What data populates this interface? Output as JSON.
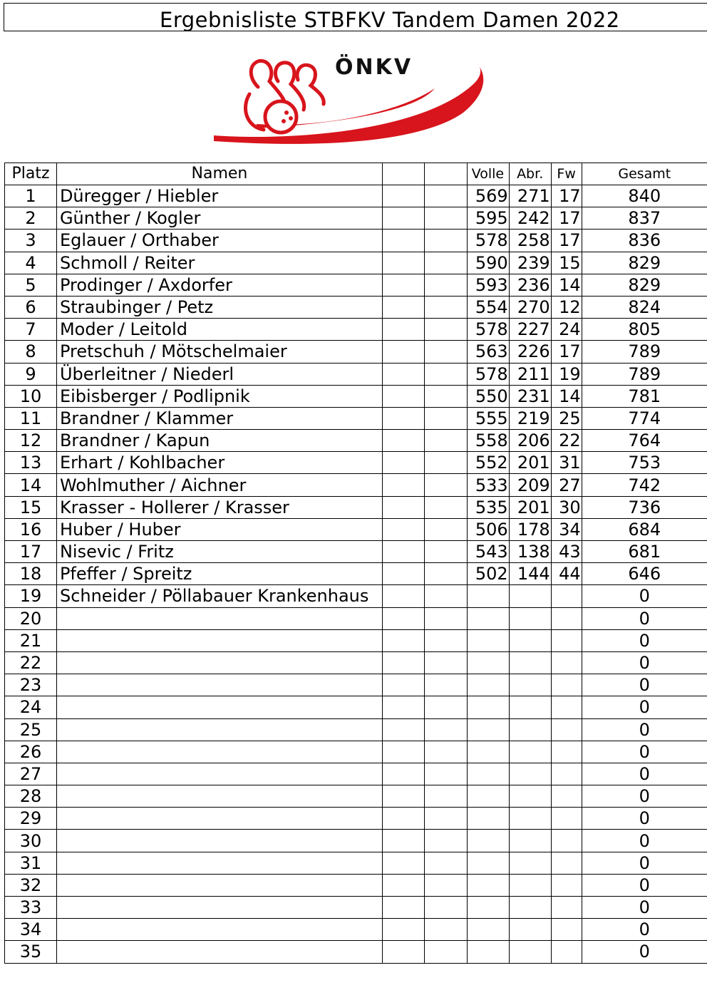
{
  "title": "Ergebnisliste STBFKV Tandem Damen 2022",
  "logo": {
    "text": "ÖNKV",
    "icon": "bowling-pin-logo",
    "colors": {
      "red": "#d8141c",
      "black": "#111111"
    }
  },
  "table": {
    "headers": {
      "platz": "Platz",
      "namen": "Namen",
      "volle": "Volle",
      "abr": "Abr.",
      "fw": "Fw",
      "gesamt": "Gesamt"
    },
    "rows": [
      {
        "platz": "1",
        "name": "Düregger / Hiebler",
        "volle": "569",
        "abr": "271",
        "fw": "17",
        "gesamt": "840"
      },
      {
        "platz": "2",
        "name": "Günther / Kogler",
        "volle": "595",
        "abr": "242",
        "fw": "17",
        "gesamt": "837"
      },
      {
        "platz": "3",
        "name": "Eglauer / Orthaber",
        "volle": "578",
        "abr": "258",
        "fw": "17",
        "gesamt": "836"
      },
      {
        "platz": "4",
        "name": "Schmoll / Reiter",
        "volle": "590",
        "abr": "239",
        "fw": "15",
        "gesamt": "829"
      },
      {
        "platz": "5",
        "name": "Prodinger / Axdorfer",
        "volle": "593",
        "abr": "236",
        "fw": "14",
        "gesamt": "829"
      },
      {
        "platz": "6",
        "name": "Straubinger / Petz",
        "volle": "554",
        "abr": "270",
        "fw": "12",
        "gesamt": "824"
      },
      {
        "platz": "7",
        "name": "Moder / Leitold",
        "volle": "578",
        "abr": "227",
        "fw": "24",
        "gesamt": "805"
      },
      {
        "platz": "8",
        "name": "Pretschuh / Mötschelmaier",
        "volle": "563",
        "abr": "226",
        "fw": "17",
        "gesamt": "789"
      },
      {
        "platz": "9",
        "name": "Überleitner / Niederl",
        "volle": "578",
        "abr": "211",
        "fw": "19",
        "gesamt": "789"
      },
      {
        "platz": "10",
        "name": "Eibisberger / Podlipnik",
        "volle": "550",
        "abr": "231",
        "fw": "14",
        "gesamt": "781"
      },
      {
        "platz": "11",
        "name": "Brandner / Klammer",
        "volle": "555",
        "abr": "219",
        "fw": "25",
        "gesamt": "774"
      },
      {
        "platz": "12",
        "name": "Brandner / Kapun",
        "volle": "558",
        "abr": "206",
        "fw": "22",
        "gesamt": "764"
      },
      {
        "platz": "13",
        "name": "Erhart / Kohlbacher",
        "volle": "552",
        "abr": "201",
        "fw": "31",
        "gesamt": "753"
      },
      {
        "platz": "14",
        "name": "Wohlmuther / Aichner",
        "volle": "533",
        "abr": "209",
        "fw": "27",
        "gesamt": "742"
      },
      {
        "platz": "15",
        "name": "Krasser - Hollerer / Krasser",
        "volle": "535",
        "abr": "201",
        "fw": "30",
        "gesamt": "736"
      },
      {
        "platz": "16",
        "name": "Huber / Huber",
        "volle": "506",
        "abr": "178",
        "fw": "34",
        "gesamt": "684"
      },
      {
        "platz": "17",
        "name": "Nisevic / Fritz",
        "volle": "543",
        "abr": "138",
        "fw": "43",
        "gesamt": "681"
      },
      {
        "platz": "18",
        "name": "Pfeffer / Spreitz",
        "volle": "502",
        "abr": "144",
        "fw": "44",
        "gesamt": "646"
      },
      {
        "platz": "19",
        "name": "Schneider / Pöllabauer  Krankenhaus",
        "volle": "",
        "abr": "",
        "fw": "",
        "gesamt": "0"
      },
      {
        "platz": "20",
        "name": "",
        "volle": "",
        "abr": "",
        "fw": "",
        "gesamt": "0"
      },
      {
        "platz": "21",
        "name": "",
        "volle": "",
        "abr": "",
        "fw": "",
        "gesamt": "0"
      },
      {
        "platz": "22",
        "name": "",
        "volle": "",
        "abr": "",
        "fw": "",
        "gesamt": "0"
      },
      {
        "platz": "23",
        "name": "",
        "volle": "",
        "abr": "",
        "fw": "",
        "gesamt": "0"
      },
      {
        "platz": "24",
        "name": "",
        "volle": "",
        "abr": "",
        "fw": "",
        "gesamt": "0"
      },
      {
        "platz": "25",
        "name": "",
        "volle": "",
        "abr": "",
        "fw": "",
        "gesamt": "0"
      },
      {
        "platz": "26",
        "name": "",
        "volle": "",
        "abr": "",
        "fw": "",
        "gesamt": "0"
      },
      {
        "platz": "27",
        "name": "",
        "volle": "",
        "abr": "",
        "fw": "",
        "gesamt": "0"
      },
      {
        "platz": "28",
        "name": "",
        "volle": "",
        "abr": "",
        "fw": "",
        "gesamt": "0"
      },
      {
        "platz": "29",
        "name": "",
        "volle": "",
        "abr": "",
        "fw": "",
        "gesamt": "0"
      },
      {
        "platz": "30",
        "name": "",
        "volle": "",
        "abr": "",
        "fw": "",
        "gesamt": "0"
      },
      {
        "platz": "31",
        "name": "",
        "volle": "",
        "abr": "",
        "fw": "",
        "gesamt": "0"
      },
      {
        "platz": "32",
        "name": "",
        "volle": "",
        "abr": "",
        "fw": "",
        "gesamt": "0"
      },
      {
        "platz": "33",
        "name": "",
        "volle": "",
        "abr": "",
        "fw": "",
        "gesamt": "0"
      },
      {
        "platz": "34",
        "name": "",
        "volle": "",
        "abr": "",
        "fw": "",
        "gesamt": "0"
      },
      {
        "platz": "35",
        "name": "",
        "volle": "",
        "abr": "",
        "fw": "",
        "gesamt": "0"
      }
    ]
  }
}
